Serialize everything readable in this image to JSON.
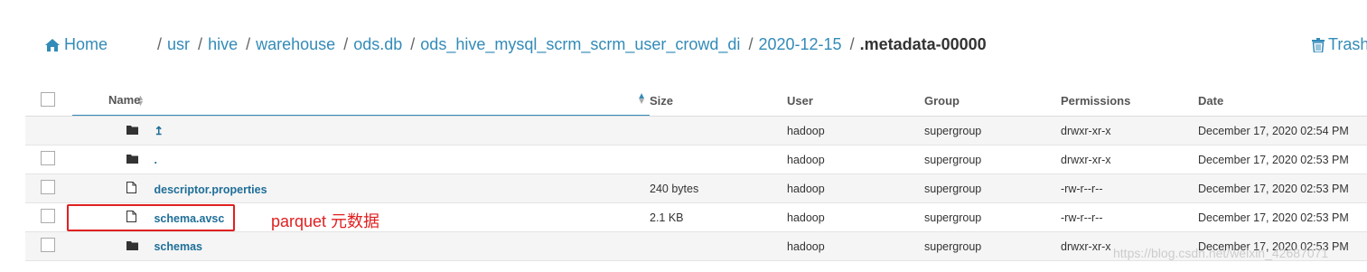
{
  "breadcrumb": {
    "home_label": "Home",
    "segments": [
      "usr",
      "hive",
      "warehouse",
      "ods.db",
      "ods_hive_mysql_scrm_scrm_user_crowd_di",
      "2020-12-15"
    ],
    "separator": "/",
    "current": ".metadata-00000"
  },
  "toolbar": {
    "trash_label": "Trash"
  },
  "table": {
    "headers": {
      "name": "Name",
      "size": "Size",
      "user": "User",
      "group": "Group",
      "permissions": "Permissions",
      "date": "Date"
    },
    "rows": [
      {
        "icon": "folder-icon",
        "name": "↥",
        "size": "",
        "user": "hadoop",
        "group": "supergroup",
        "permissions": "drwxr-xr-x",
        "date": "December 17, 2020 02:54 PM"
      },
      {
        "icon": "folder-icon",
        "name": ".",
        "size": "",
        "user": "hadoop",
        "group": "supergroup",
        "permissions": "drwxr-xr-x",
        "date": "December 17, 2020 02:53 PM"
      },
      {
        "icon": "file-icon",
        "name": "descriptor.properties",
        "size": "240 bytes",
        "user": "hadoop",
        "group": "supergroup",
        "permissions": "-rw-r--r--",
        "date": "December 17, 2020 02:53 PM"
      },
      {
        "icon": "file-icon",
        "name": "schema.avsc",
        "size": "2.1 KB",
        "user": "hadoop",
        "group": "supergroup",
        "permissions": "-rw-r--r--",
        "date": "December 17, 2020 02:53 PM"
      },
      {
        "icon": "folder-icon",
        "name": "schemas",
        "size": "",
        "user": "hadoop",
        "group": "supergroup",
        "permissions": "drwxr-xr-x",
        "date": "December 17, 2020 02:53 PM"
      }
    ]
  },
  "annotation": {
    "text": "parquet 元数据",
    "color": "#e02020"
  },
  "watermark": "https://blog.csdn.net/weixin_42687071",
  "colors": {
    "link": "#338bb8",
    "name_link": "#1e6e98",
    "stripe": "#f5f5f5"
  }
}
